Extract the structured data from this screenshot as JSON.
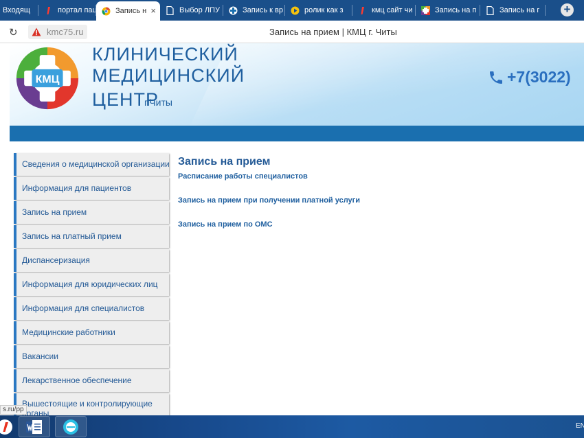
{
  "browser": {
    "tabs": [
      {
        "label": "Входящ",
        "icon": "mail-icon",
        "width": 56,
        "active": false
      },
      {
        "label": "портал пац",
        "icon": "yandex-icon",
        "width": 84,
        "active": false
      },
      {
        "label": "Запись н",
        "icon": "chrome-icon",
        "width": 93,
        "active": true
      },
      {
        "label": "Выбор ЛПУ",
        "icon": "page-icon",
        "width": 92,
        "active": false
      },
      {
        "label": "Запись к вр",
        "icon": "medical-cross-icon",
        "width": 90,
        "active": false
      },
      {
        "label": "ролик как з",
        "icon": "youtube-icon",
        "width": 98,
        "active": false
      },
      {
        "label": "кмц сайт чи",
        "icon": "yandex-icon",
        "width": 92,
        "active": false
      },
      {
        "label": "Запись на п",
        "icon": "kmc-favicon-icon",
        "width": 94,
        "active": false
      },
      {
        "label": "Запись на г",
        "icon": "page-icon",
        "width": 95,
        "active": false
      }
    ],
    "new_tab": "+",
    "url": "kmc75.ru",
    "page_title": "Запись на прием | КМЦ г. Читы",
    "accent": "#1a4f8a"
  },
  "header": {
    "logo_text": "КМЦ",
    "title_line1": "КЛИНИЧЕСКИЙ",
    "title_line2": "МЕДИЦИНСКИЙ",
    "title_line3": "ЦЕНТР",
    "city": "г.Читы",
    "phone": "+7(3022)"
  },
  "sidebar": {
    "items": [
      {
        "label": "Сведения о медицинской организации"
      },
      {
        "label": "Информация для пациентов"
      },
      {
        "label": "Запись на прием"
      },
      {
        "label": "Запись на платный прием"
      },
      {
        "label": "Диспансеризация"
      },
      {
        "label": "Информация для юридических лиц"
      },
      {
        "label": "Информация для специалистов"
      },
      {
        "label": "Медицинские работники"
      },
      {
        "label": "Вакансии"
      },
      {
        "label": "Лекарственное обеспечение"
      },
      {
        "label": "Вышестоящие и контролирующие органы"
      }
    ]
  },
  "content": {
    "title": "Запись на прием",
    "links": [
      "Расписание работы специалистов",
      "Запись на прием при получении платной услуги",
      "Запись на прием по ОМС"
    ]
  },
  "status_url": "s.ru/pp",
  "taskbar": {
    "lang": "EN"
  }
}
